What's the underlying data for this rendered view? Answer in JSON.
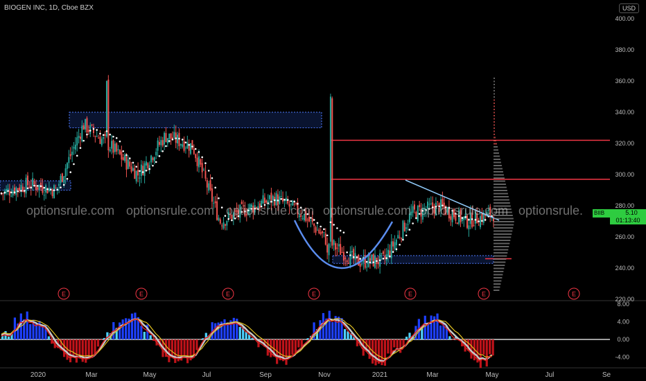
{
  "header": {
    "title": "BIOGEN INC, 1D, Cboe BZX",
    "currency": "USD"
  },
  "price_tag": {
    "ticker": "BIIB",
    "price": "275.10",
    "countdown": "01:13:40"
  },
  "watermark": [
    "optionsrule.com",
    "optionsrule.com",
    "optionsrule.com",
    "optionsrule.com",
    "optionsrule.com",
    "optionsrule."
  ],
  "earnings_marker": "E",
  "colors": {
    "up": "#26a69a",
    "down": "#ef5350",
    "level_lines": "#f23645",
    "zone": "#1e3a8a",
    "trend": "#90caf9",
    "cup": "#5b8def"
  },
  "chart_data": [
    {
      "type": "candlestick",
      "title": "BIOGEN INC, 1D, Cboe BZX",
      "x_ticks": [
        "2020",
        "Mar",
        "May",
        "Jul",
        "Sep",
        "Nov",
        "2021",
        "Mar",
        "May",
        "Jul",
        "Se"
      ],
      "y_ticks": [
        220,
        240,
        260,
        280,
        300,
        320,
        340,
        360,
        380,
        400
      ],
      "ylim": [
        220,
        405
      ],
      "close_path": [
        {
          "m": "Oct 2019",
          "v": 288
        },
        {
          "m": "Nov 2019",
          "v": 294
        },
        {
          "m": "Dec 2019",
          "v": 290
        },
        {
          "m": "Jan 2020",
          "v": 332
        },
        {
          "m": "Feb 2020",
          "v": 318
        },
        {
          "m": "Mar 2020",
          "v": 300
        },
        {
          "m": "Apr 2020",
          "v": 325
        },
        {
          "m": "May 2020",
          "v": 318
        },
        {
          "m": "Jun 2020",
          "v": 270
        },
        {
          "m": "Jul 2020",
          "v": 278
        },
        {
          "m": "Aug 2020",
          "v": 285
        },
        {
          "m": "Sep 2020",
          "v": 275
        },
        {
          "m": "Oct 2020",
          "v": 256
        },
        {
          "m": "Nov 2020",
          "v": 244
        },
        {
          "m": "Dec 2020",
          "v": 245
        },
        {
          "m": "Jan 2021",
          "v": 275
        },
        {
          "m": "Feb 2021",
          "v": 280
        },
        {
          "m": "Mar 2021",
          "v": 270
        },
        {
          "m": "Apr 2021",
          "v": 275
        }
      ],
      "horizontal_levels": [
        322,
        297,
        246
      ],
      "zones": [
        [
          330,
          340
        ],
        [
          290,
          296
        ],
        [
          243,
          248
        ]
      ],
      "earnings_markers": [
        "Jan 2020",
        "Apr 2020",
        "Jul 2020",
        "Oct 2020",
        "Feb 2021",
        "Apr 2021",
        "Jul 2021"
      ],
      "last_price": 275.1
    },
    {
      "type": "line",
      "title": "",
      "y_ticks": [
        "8.00",
        "4.00",
        "0.00",
        "-4.00"
      ],
      "ylim": [
        -6.5,
        8.5
      ],
      "zero_line": 0
    }
  ]
}
